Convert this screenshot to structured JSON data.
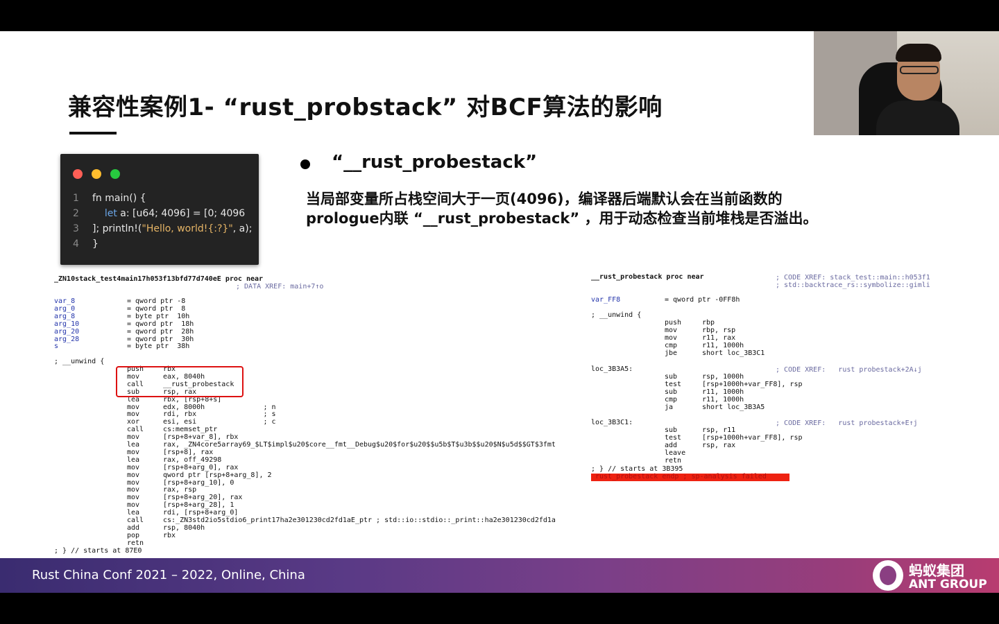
{
  "slide": {
    "title": "兼容性案例1- “rust_probstack” 对BCF算法的影响",
    "bullet_heading": "“__rust_probestack”",
    "bullet_line1": "当局部变量所占栈空间大于一页(4096)，编译器后端默认会在当前函数的",
    "bullet_line2": "prologue内联 “__rust_probestack” ，用于动态检查当前堆栈是否溢出。"
  },
  "code_card": {
    "dot_colors": [
      "#ff5f56",
      "#ffbd2e",
      "#27c93f"
    ],
    "lines": [
      {
        "num": "1",
        "pre": "fn main() {",
        "kw": "",
        "rest": "",
        "str": "",
        "post": ""
      },
      {
        "num": "2",
        "pre": "    ",
        "kw": "let",
        "rest": " a: [u64; 4096] = [0; 4096",
        "str": "",
        "post": ""
      },
      {
        "num": "3",
        "pre": "]; println!(",
        "kw": "",
        "rest": "",
        "str": "\"Hello, world!{:?}\"",
        "post": ", a);"
      },
      {
        "num": "4",
        "pre": "}",
        "kw": "",
        "rest": "",
        "str": "",
        "post": ""
      }
    ]
  },
  "asm_left": {
    "header": "_ZN10stack_test4main17h053f13bfd77d740eE proc near",
    "xref": "; DATA XREF: main+7↑o",
    "vars": [
      [
        "var_8",
        "= qword ptr -8"
      ],
      [
        "arg_0",
        "= qword ptr  8"
      ],
      [
        "arg_8",
        "= byte ptr  10h"
      ],
      [
        "arg_10",
        "= qword ptr  18h"
      ],
      [
        "arg_20",
        "= qword ptr  28h"
      ],
      [
        "arg_28",
        "= qword ptr  30h"
      ],
      [
        "s",
        "= byte ptr  38h"
      ]
    ],
    "unwind": "; __unwind {",
    "instrs": [
      [
        "push",
        "rbx"
      ],
      [
        "mov",
        "eax, 8040h"
      ],
      [
        "call",
        "__rust_probestack"
      ],
      [
        "sub",
        "rsp, rax"
      ],
      [
        "lea",
        "rbx, [rsp+8+s]"
      ],
      [
        "mov",
        "edx, 8000h              ; n"
      ],
      [
        "mov",
        "rdi, rbx                ; s"
      ],
      [
        "xor",
        "esi, esi                ; c"
      ],
      [
        "call",
        "cs:memset_ptr"
      ],
      [
        "mov",
        "[rsp+8+var_8], rbx"
      ],
      [
        "lea",
        "rax, _ZN4core5array69_$LT$impl$u20$core__fmt__Debug$u20$for$u20$$u5b$T$u3b$$u20$N$u5d$$GT$3fmt"
      ],
      [
        "mov",
        "[rsp+8], rax"
      ],
      [
        "lea",
        "rax, off_49298"
      ],
      [
        "mov",
        "[rsp+8+arg_0], rax"
      ],
      [
        "mov",
        "qword ptr [rsp+8+arg_8], 2"
      ],
      [
        "mov",
        "[rsp+8+arg_10], 0"
      ],
      [
        "mov",
        "rax, rsp"
      ],
      [
        "mov",
        "[rsp+8+arg_20], rax"
      ],
      [
        "mov",
        "[rsp+8+arg_28], 1"
      ],
      [
        "lea",
        "rdi, [rsp+8+arg_0]"
      ],
      [
        "call",
        "cs:_ZN3std2io5stdio6_print17ha2e301230cd2fd1aE_ptr ; std::io::stdio::_print::ha2e301230cd2fd1a"
      ],
      [
        "add",
        "rsp, 8040h"
      ],
      [
        "pop",
        "rbx"
      ],
      [
        "retn",
        ""
      ]
    ],
    "footer": "; } // starts at 87E0"
  },
  "asm_right": {
    "header": "__rust_probestack proc near",
    "xref1": "; CODE XREF: stack_test::main::h053f1",
    "xref2": "; std::backtrace_rs::symbolize::gimli",
    "var": [
      "var_FF8",
      "= qword ptr -0FF8h"
    ],
    "unwind": "; __unwind {",
    "block1": [
      [
        "push",
        "rbp"
      ],
      [
        "mov",
        "rbp, rsp"
      ],
      [
        "mov",
        "r11, rax"
      ],
      [
        "cmp",
        "r11, 1000h"
      ],
      [
        "jbe",
        "short loc_3B3C1"
      ]
    ],
    "loc1": "loc_3B3A5:",
    "loc1_xref": "; CODE XREF:   rust probestack+2A↓j",
    "block2": [
      [
        "sub",
        "rsp, 1000h"
      ],
      [
        "test",
        "[rsp+1000h+var_FF8], rsp"
      ],
      [
        "sub",
        "r11, 1000h"
      ],
      [
        "cmp",
        "r11, 1000h"
      ],
      [
        "ja",
        "short loc_3B3A5"
      ]
    ],
    "loc2": "loc_3B3C1:",
    "loc2_xref": "; CODE XREF:   rust probestack+E↑j",
    "block3": [
      [
        "sub",
        "rsp, r11"
      ],
      [
        "test",
        "[rsp+1000h+var_FF8], rsp"
      ],
      [
        "add",
        "rsp, rax"
      ],
      [
        "leave",
        ""
      ],
      [
        "retn",
        ""
      ]
    ],
    "footer": "; } // starts at 3B395",
    "error": "rust_probestack endp ; sp-analysis failed"
  },
  "footer": {
    "conf_text": "Rust China Conf 2021 – 2022, Online, China",
    "brand_cn": "蚂蚁集团",
    "brand_en": "ANT GROUP"
  }
}
